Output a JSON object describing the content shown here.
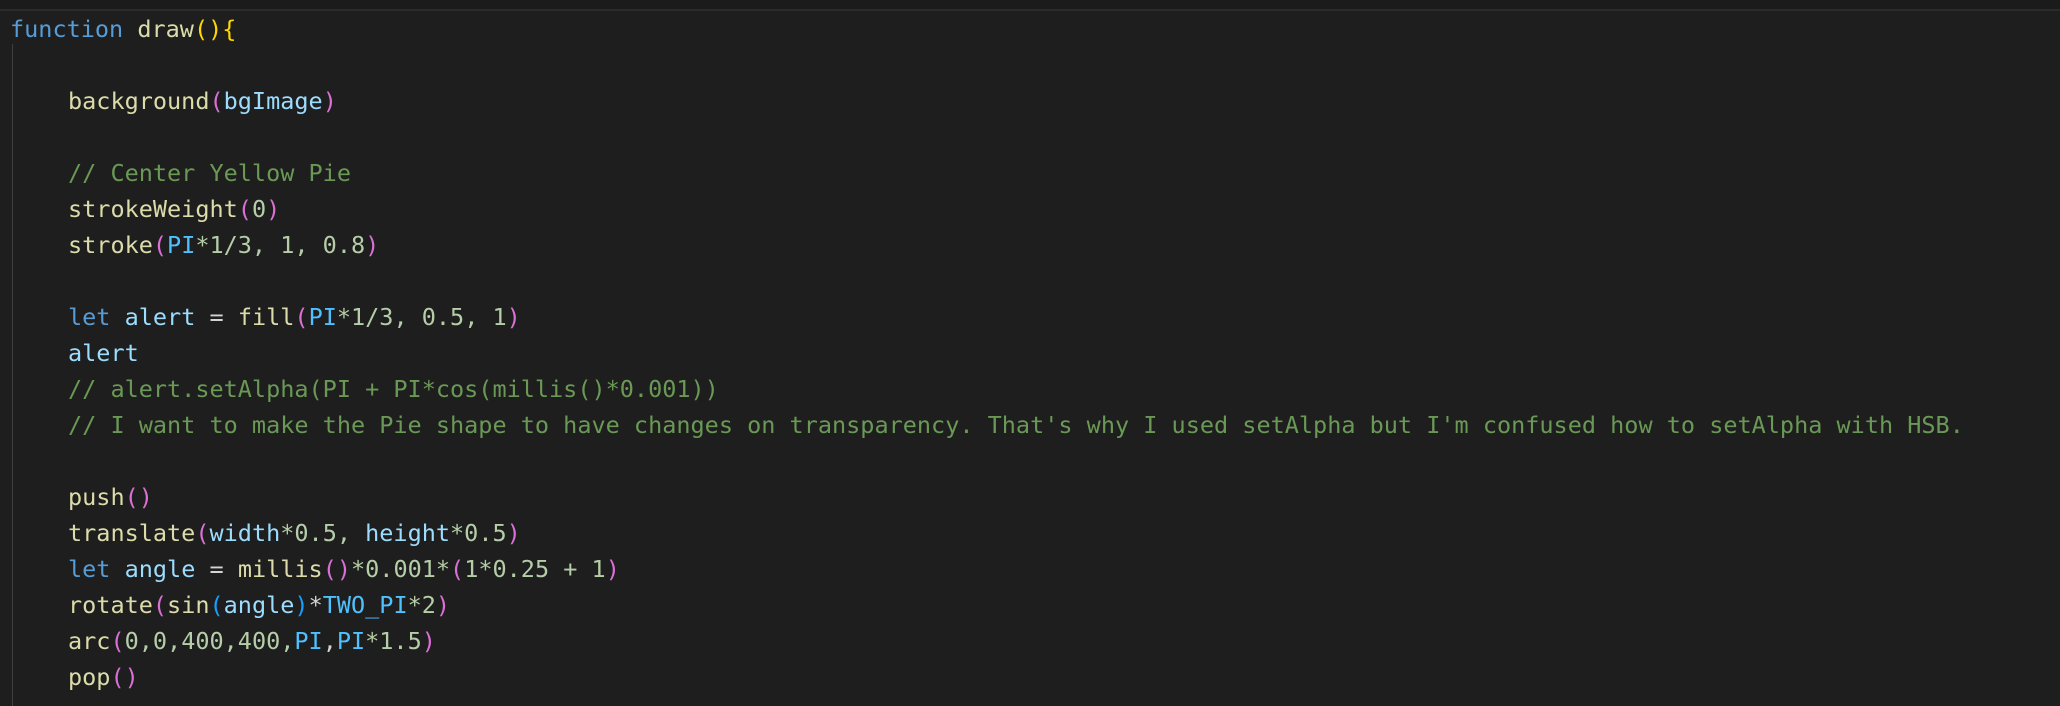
{
  "colors": {
    "background": "#1e1e1e",
    "keyword": "#569cd6",
    "function": "#dcdcaa",
    "variable": "#9cdcfe",
    "constant": "#4fc1ff",
    "number": "#b5cea8",
    "comment": "#6a9955",
    "bracket_level_1": "#ffd700",
    "bracket_level_2": "#da70d6",
    "bracket_level_3": "#179fff"
  },
  "code": {
    "l1": {
      "kw": "function",
      "name": "draw",
      "open": "()",
      "brace": "{"
    },
    "l3": {
      "fn": "background",
      "p1": "(",
      "arg": "bgImage",
      "p2": ")"
    },
    "l5": {
      "comment": "// Center Yellow Pie"
    },
    "l6": {
      "fn": "strokeWeight",
      "p1": "(",
      "arg": "0",
      "p2": ")"
    },
    "l7": {
      "fn": "stroke",
      "p1": "(",
      "pi": "PI",
      "rest": "*1/3, 1, 0.8",
      "p2": ")"
    },
    "l9": {
      "kw": "let",
      "var": "alert",
      "eq": " = ",
      "fn": "fill",
      "p1": "(",
      "pi": "PI",
      "rest": "*1/3, 0.5, 1",
      "p2": ")"
    },
    "l10": {
      "var": "alert"
    },
    "l11": {
      "comment": "// alert.setAlpha(PI + PI*cos(millis()*0.001))"
    },
    "l12": {
      "comment": "// I want to make the Pie shape to have changes on transparency. That's why I used setAlpha but I'm confused how to setAlpha with HSB."
    },
    "l14": {
      "fn": "push",
      "parens": "()"
    },
    "l15": {
      "fn": "translate",
      "p1": "(",
      "a": "width",
      "b": "*0.5, ",
      "c": "height",
      "d": "*0.5",
      "p2": ")"
    },
    "l16": {
      "kw": "let",
      "var": "angle",
      "eq": " = ",
      "fn": "millis",
      "p1": "()",
      "mid": "*0.001*",
      "p2": "(",
      "inner": "1*0.25 + 1",
      "p3": ")"
    },
    "l17": {
      "fn": "rotate",
      "p1": "(",
      "fn2": "sin",
      "p2": "(",
      "var": "angle",
      "p3": ")",
      "op": "*",
      "cst": "TWO_PI",
      "tail": "*2",
      "p4": ")"
    },
    "l18": {
      "fn": "arc",
      "p1": "(",
      "nums": "0,0,400,400,",
      "pi1": "PI",
      "comma": ",",
      "pi2": "PI",
      "tail": "*1.5",
      "p2": ")"
    },
    "l19": {
      "fn": "pop",
      "parens": "()"
    }
  }
}
